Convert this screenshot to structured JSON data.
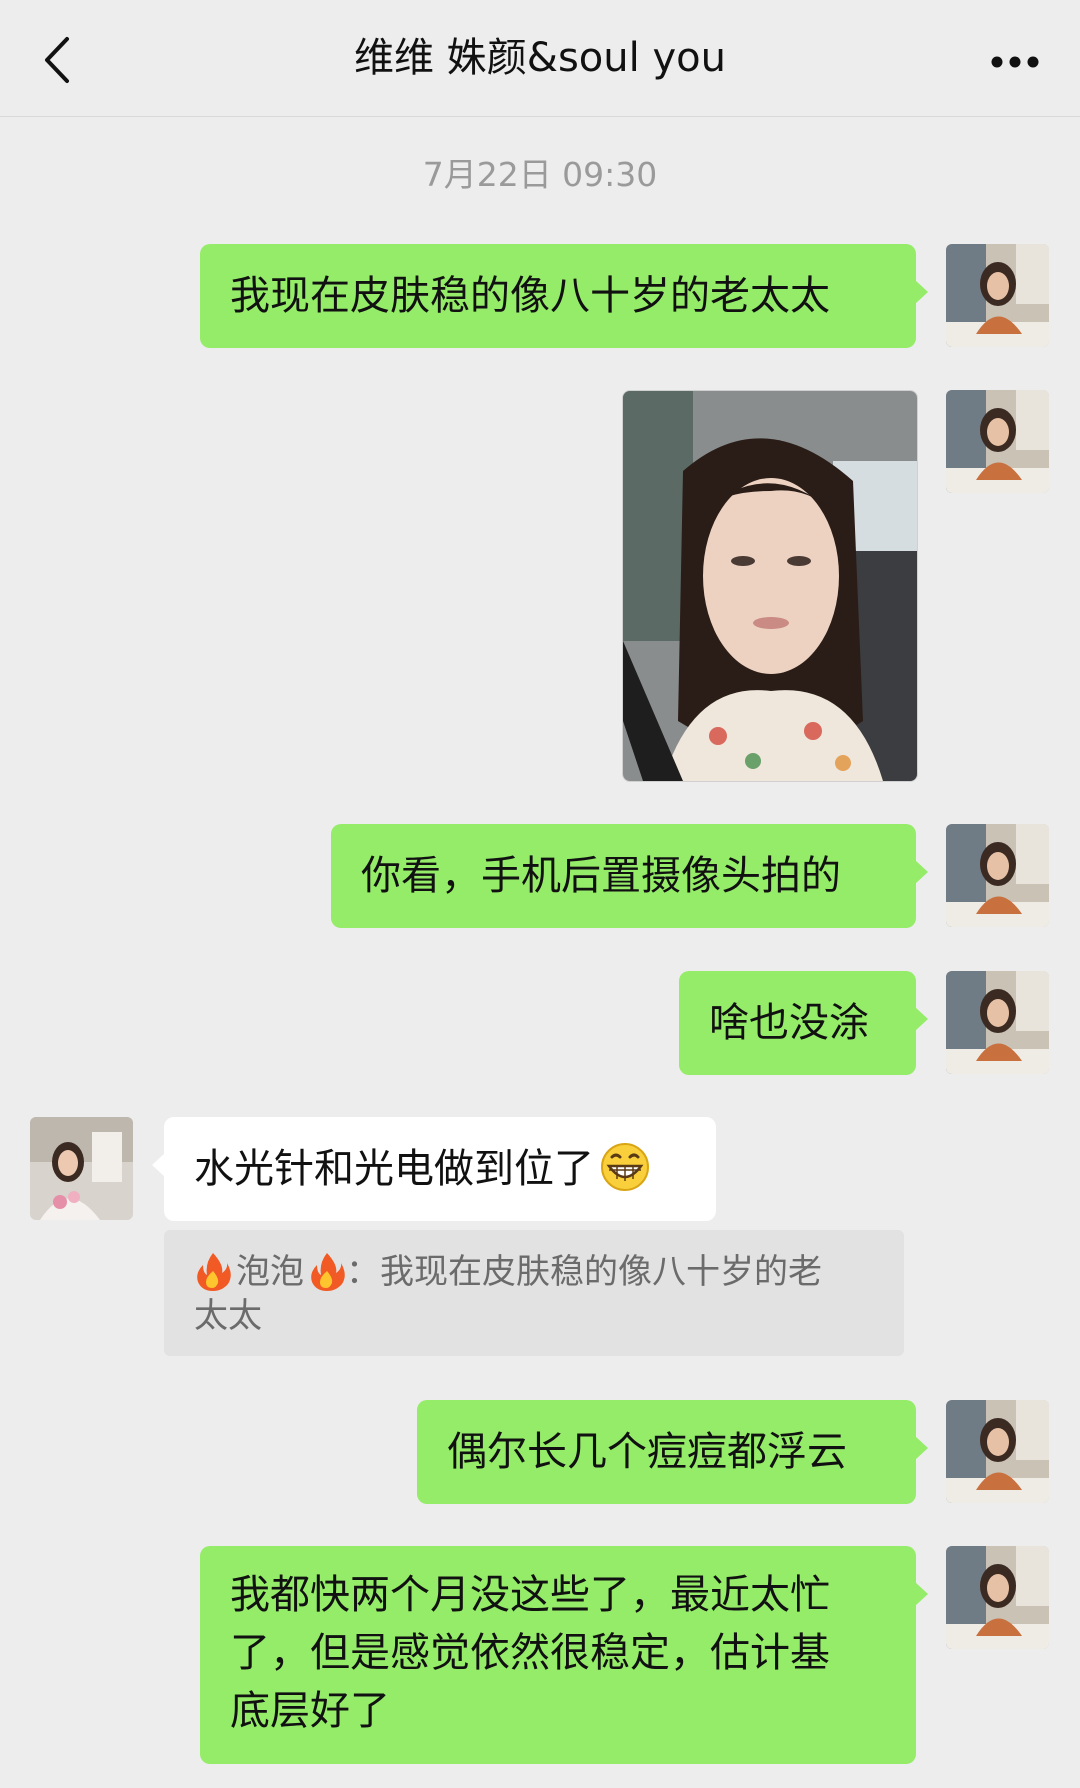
{
  "header": {
    "title": "维维 姝颜&soul you",
    "back_icon": "chevron-left-icon",
    "more_icon": "more-dots-icon"
  },
  "timestamp": "7月22日 09:30",
  "messages": [
    {
      "sender": "me",
      "text": "我现在皮肤稳的像八十岁的老太太"
    },
    {
      "sender": "me",
      "type": "image"
    },
    {
      "sender": "me",
      "text": "你看，手机后置摄像头拍的"
    },
    {
      "sender": "me",
      "text": "啥也没涂"
    },
    {
      "sender": "other",
      "text": "水光针和光电做到位了",
      "emoji": "grinning-face-icon"
    },
    {
      "sender": "me",
      "text": "偶尔长几个痘痘都浮云"
    },
    {
      "sender": "me",
      "text_lines": [
        "我都快两个月没这些了，最近太忙",
        "了，但是感觉依然很稳定，估计基",
        "底层好了"
      ]
    }
  ],
  "quote": {
    "name": "泡泡",
    "separator": "：",
    "text_line1": "我现在皮肤稳的像八十岁的老",
    "text_line2": "太太",
    "icon": "fire-icon"
  },
  "colors": {
    "background": "#ededed",
    "my_bubble": "#95ec69",
    "other_bubble": "#ffffff",
    "quote_bg": "#e2e2e2"
  }
}
